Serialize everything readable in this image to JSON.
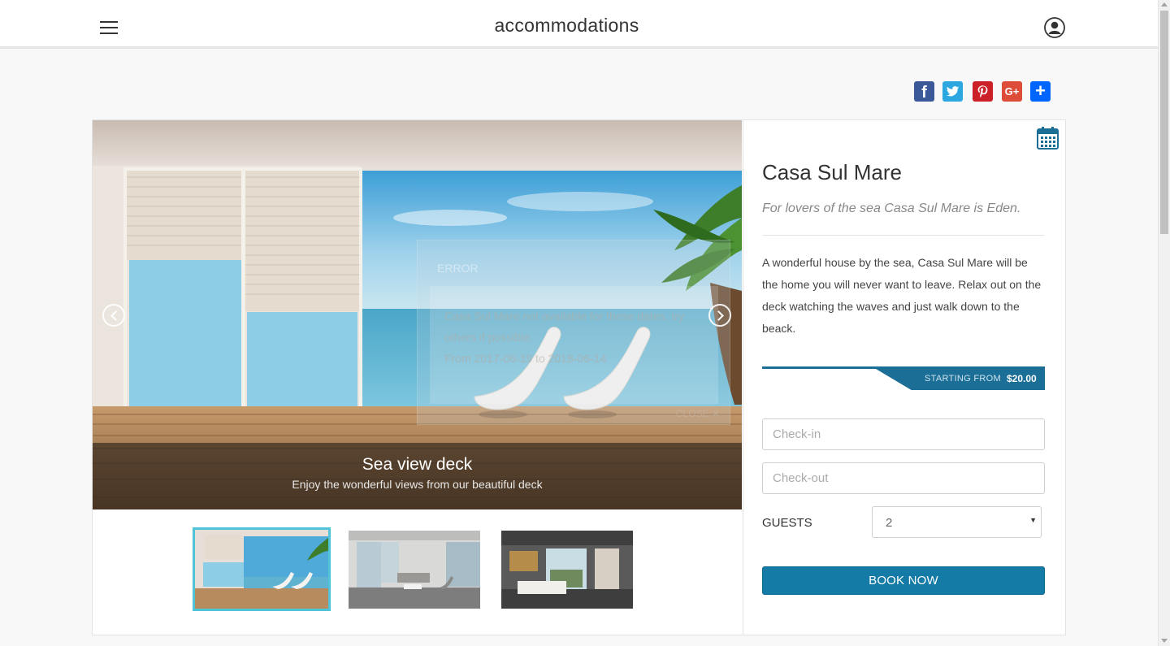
{
  "header": {
    "title": "accommodations",
    "menu_icon": "hamburger-menu-icon",
    "account_icon": "user-account-icon"
  },
  "share": {
    "facebook": "f",
    "twitter_icon": "twitter-icon",
    "pinterest_icon": "pinterest-icon",
    "googleplus": "G+",
    "share": "+"
  },
  "slider": {
    "caption_title": "Sea view deck",
    "caption_subtitle": "Enjoy the wonderful views from our beautiful deck",
    "active_slide": 1,
    "slide_count": 3
  },
  "error_modal": {
    "title": "ERROR",
    "message": "Casa Sul Mare not available for these dates, try others if possible.",
    "range": "From 2017-06-19 to 2018-06-14",
    "close_label": "CLOSE ✕"
  },
  "property": {
    "name": "Casa Sul Mare",
    "tagline": "For lovers of the sea Casa Sul Mare is Eden.",
    "description": "A wonderful house by the sea, Casa Sul Mare will be the home you will never want to leave. Relax out on the deck watching the waves and just walk down to the beack.",
    "price_label": "STARTING FROM",
    "price_value": "$20.00"
  },
  "booking": {
    "checkin_placeholder": "Check-in",
    "checkout_placeholder": "Check-out",
    "guests_label": "GUESTS",
    "guests_value": "2",
    "book_label": "BOOK NOW"
  },
  "colors": {
    "accent": "#147ba7",
    "thumb_active_border": "#4fc3d8"
  }
}
